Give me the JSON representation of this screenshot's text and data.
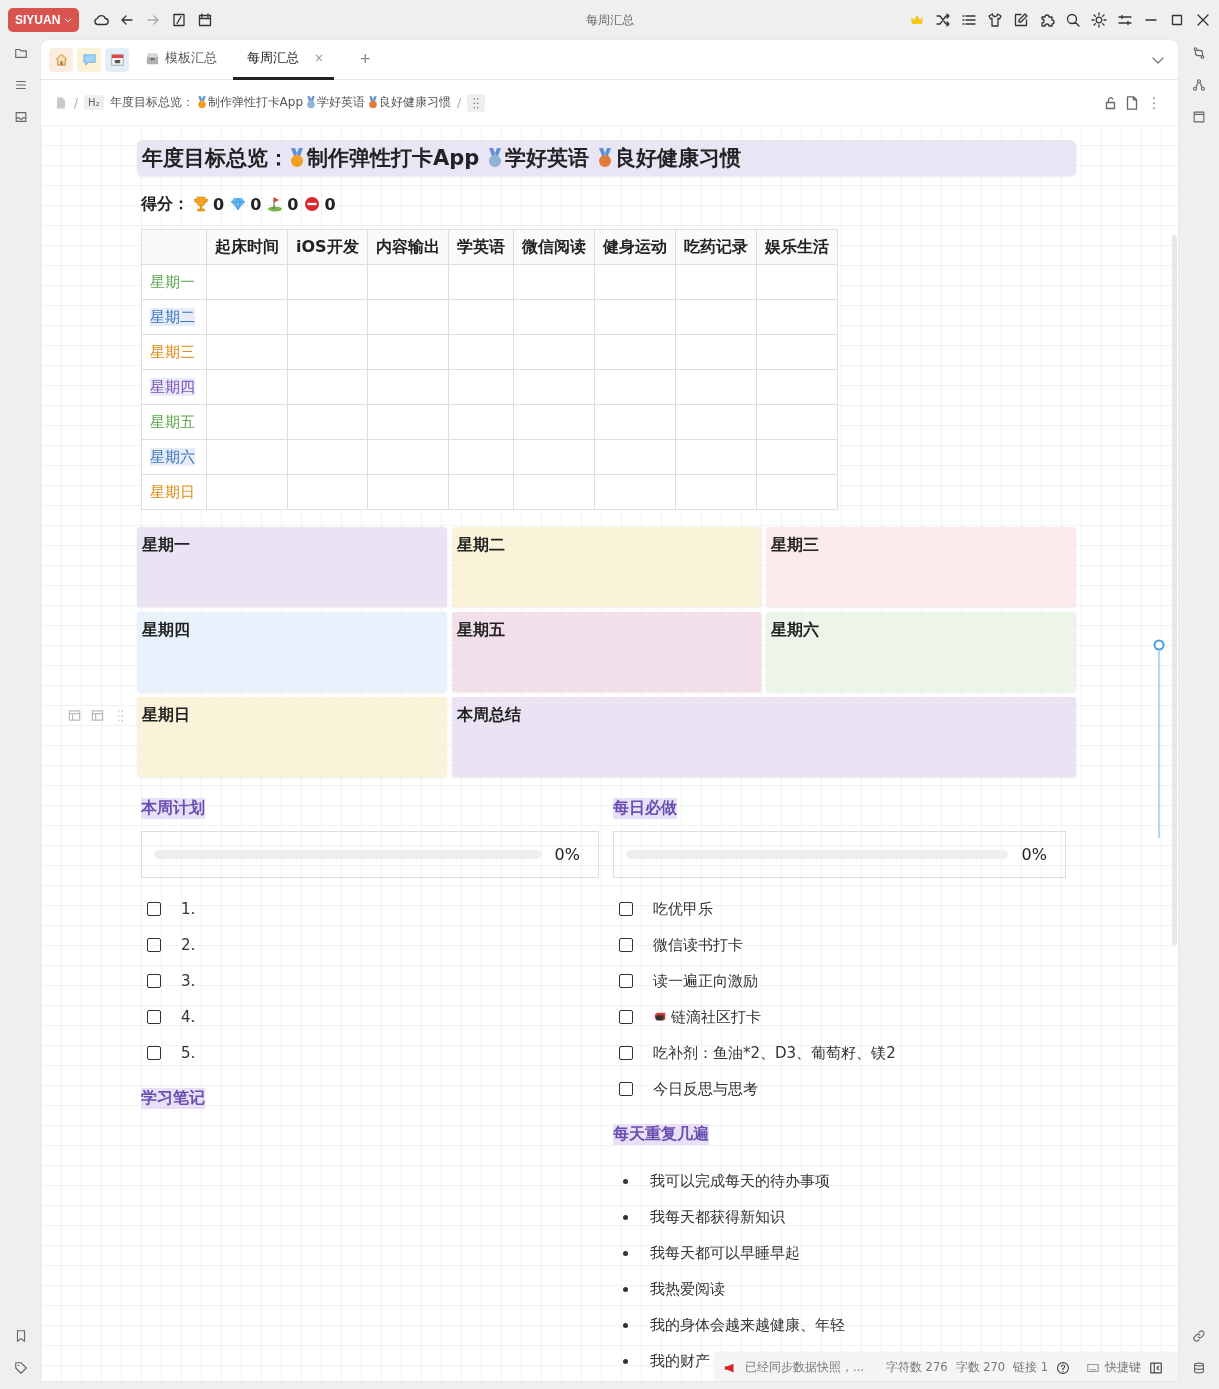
{
  "app": {
    "logo": "SIYUAN",
    "title": "每周汇总"
  },
  "tabs": [
    {
      "kind": "home",
      "selected": false
    },
    {
      "kind": "chat",
      "selected": false
    },
    {
      "kind": "calendar",
      "selected": false
    },
    {
      "kind": "box",
      "label": "模板汇总",
      "selected": false
    },
    {
      "kind": "doc",
      "label": "每周汇总",
      "selected": true,
      "close": "×"
    }
  ],
  "new_tab": "+",
  "breadcrumb": {
    "separator": "/",
    "heading_badge": "H₂",
    "prefix": "年度目标总览：",
    "goals": [
      {
        "text": "制作弹性打卡App",
        "color": "#f0a020"
      },
      {
        "text": "学好英语",
        "color": "#8fb3d0"
      },
      {
        "text": "良好健康习惯",
        "color": "#e07b39"
      }
    ]
  },
  "title": {
    "prefix": "年度目标总览：",
    "goals": [
      {
        "text": "制作弹性打卡App",
        "color": "#f0a020"
      },
      {
        "text": "学好英语",
        "color": "#8fb3d0"
      },
      {
        "text": "良好健康习惯",
        "color": "#e07b39"
      }
    ]
  },
  "score": {
    "label": "得分：",
    "items": [
      {
        "kind": "trophy",
        "value": "0"
      },
      {
        "kind": "diamond",
        "value": "0"
      },
      {
        "kind": "flag",
        "value": "0"
      },
      {
        "kind": "stop",
        "value": "0"
      }
    ]
  },
  "table": {
    "columns": [
      "起床时间",
      "iOS开发",
      "内容输出",
      "学英语",
      "微信阅读",
      "健身运动",
      "吃药记录",
      "娱乐生活"
    ],
    "rows": [
      {
        "label": "星期一",
        "color": "#5aa64a",
        "highlight": false
      },
      {
        "label": "星期二",
        "color": "#3a78c2",
        "highlight": true
      },
      {
        "label": "星期三",
        "color": "#e08a10",
        "highlight": false
      },
      {
        "label": "星期四",
        "color": "#7b4fc0",
        "highlight": true
      },
      {
        "label": "星期五",
        "color": "#5aa64a",
        "highlight": false
      },
      {
        "label": "星期六",
        "color": "#3a78c2",
        "highlight": true
      },
      {
        "label": "星期日",
        "color": "#e08a10",
        "highlight": false
      }
    ]
  },
  "cards": [
    {
      "title": "星期一",
      "color": "#e9e3f3",
      "wide": false
    },
    {
      "title": "星期二",
      "color": "#faf3d9",
      "wide": false
    },
    {
      "title": "星期三",
      "color": "#fbeaea",
      "wide": false
    },
    {
      "title": "星期四",
      "color": "#e7f2fc",
      "wide": false
    },
    {
      "title": "星期五",
      "color": "#f1e0ea",
      "wide": false
    },
    {
      "title": "星期六",
      "color": "#edf5ea",
      "wide": false
    },
    {
      "title": "星期日",
      "color": "#faf3d9",
      "wide": false
    },
    {
      "title": "本周总结",
      "color": "#e9e3f3",
      "wide": true
    }
  ],
  "weekly_plan": {
    "heading": "本周计划",
    "progress": {
      "level": 0,
      "reading": "0%"
    },
    "tasks": [
      {
        "text": "1.",
        "checked": false
      },
      {
        "text": "2.",
        "checked": false
      },
      {
        "text": "3.",
        "checked": false
      },
      {
        "text": "4.",
        "checked": false
      },
      {
        "text": "5.",
        "checked": false
      }
    ],
    "notes_heading": "学习笔记"
  },
  "daily": {
    "heading": "每日必做",
    "progress": {
      "level": 0,
      "reading": "0%"
    },
    "tasks": [
      {
        "text": "吃优甲乐",
        "checked": false,
        "icon": false
      },
      {
        "text": "微信读书打卡",
        "checked": false,
        "icon": false
      },
      {
        "text": "读一遍正向激励",
        "checked": false,
        "icon": false
      },
      {
        "text": "链滴社区打卡",
        "checked": false,
        "icon": true
      },
      {
        "text": "吃补剂：鱼油*2、D3、葡萄籽、镁2",
        "checked": false,
        "icon": false
      },
      {
        "text": "今日反思与思考",
        "checked": false,
        "icon": false
      }
    ]
  },
  "repeat": {
    "heading": "每天重复几遍",
    "items": [
      "我可以完成每天的待办事项",
      "我每天都获得新知识",
      "我每天都可以早睡早起",
      "我热爱阅读",
      "我的身体会越来越健康、年轻",
      "我的财产"
    ]
  },
  "status_bar": {
    "message": "已经同步数据快照，...",
    "chars": "字符数 276",
    "words": "字数 270",
    "links": "链接 1",
    "shortcuts": "快捷键"
  }
}
